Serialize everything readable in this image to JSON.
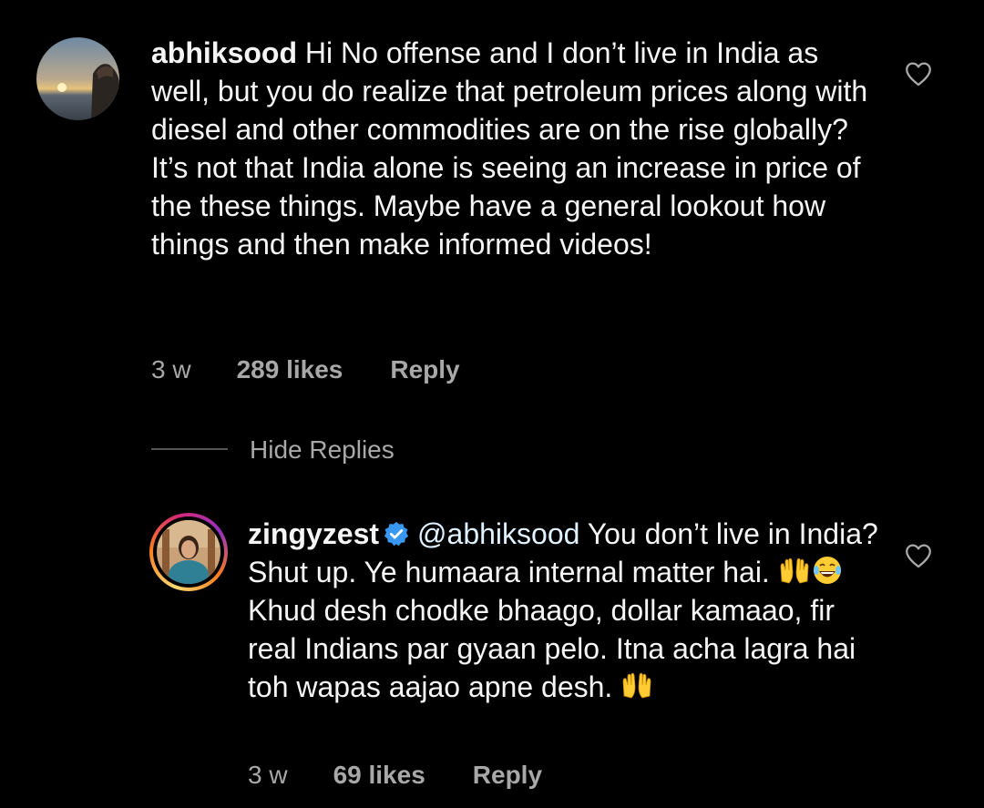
{
  "comments": [
    {
      "username": "abhiksood",
      "text": "Hi No offense and I don’t live in India as well, but you do realize that petroleum prices along with diesel and other commodities are on the rise globally?\nIt’s not that India alone is seeing an increase in price of the these things. Maybe have a general lookout how things and then make informed videos!",
      "time": "3 w",
      "likes": "289 likes",
      "reply_label": "Reply"
    }
  ],
  "hide_replies_label": "Hide Replies",
  "replies": [
    {
      "username": "zingyzest",
      "verified": true,
      "mention": "@abhiksood",
      "text_line1": " You don’t live in India? Shut up. Ye humaara internal matter hai. ",
      "text_line2": "Khud desh chodke bhaago, dollar kamaao, fir real Indians par gyaan pelo. Itna acha lagra hai toh wapas aajao apne desh. ",
      "time": "3 w",
      "likes": "69 likes",
      "reply_label": "Reply"
    }
  ],
  "colors": {
    "background": "#000000",
    "text": "#f5f5f5",
    "secondary": "#a8a8a8",
    "verified": "#3897f0"
  },
  "icons": [
    "heart-outline-icon",
    "verified-badge-icon",
    "raising-hands-emoji",
    "joy-emoji"
  ]
}
